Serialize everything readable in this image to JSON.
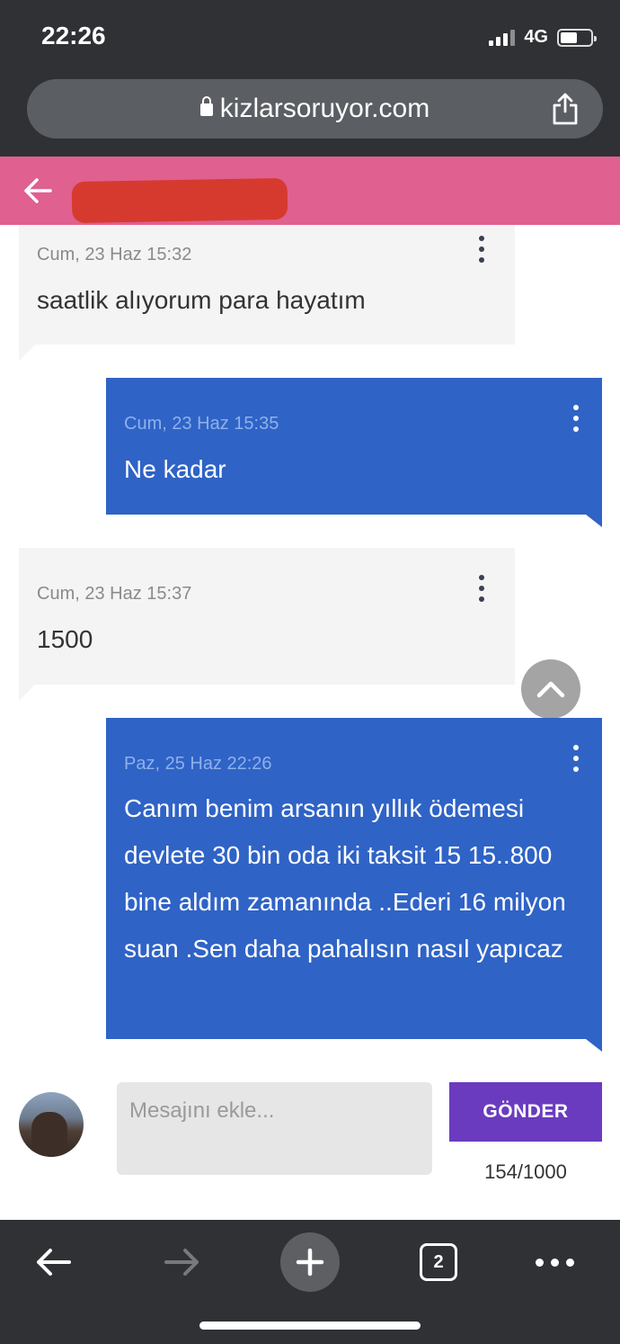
{
  "status": {
    "time": "22:26",
    "network": "4G"
  },
  "browser": {
    "url": "kizlarsoruyor.com"
  },
  "messages": [
    {
      "direction": "incoming",
      "time": "Cum, 23 Haz 15:32",
      "text": "saatlik alıyorum para hayatım"
    },
    {
      "direction": "outgoing",
      "time": "Cum, 23 Haz 15:35",
      "text": "Ne kadar"
    },
    {
      "direction": "incoming",
      "time": "Cum, 23 Haz 15:37",
      "text": "1500"
    },
    {
      "direction": "outgoing",
      "time": "Paz, 25 Haz 22:26",
      "text": "Canım benim arsanın yıllık ödemesi devlete 30 bin oda iki taksit 15 15..800 bine aldım zamanında ..Ederi 16 milyon suan .Sen daha pahalısın nasıl yapıcaz"
    }
  ],
  "composer": {
    "placeholder": "Mesajını ekle...",
    "send_label": "GÖNDER",
    "counter": "154/1000"
  },
  "toolbar": {
    "tab_count": "2"
  },
  "colors": {
    "header": "#e0608f",
    "outgoing_bubble": "#2f63c6",
    "incoming_bubble": "#f4f4f4",
    "send_button": "#6a3bbf"
  }
}
